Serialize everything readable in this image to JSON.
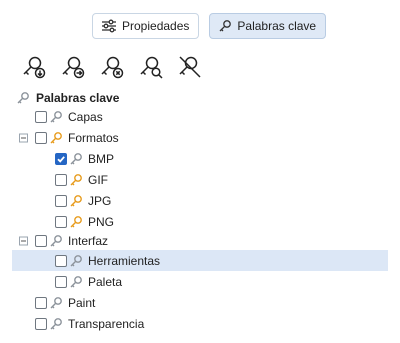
{
  "tabs": [
    {
      "label": "Propiedades",
      "icon": "sliders-icon",
      "active": false
    },
    {
      "label": "Palabras clave",
      "icon": "key-icon",
      "active": true
    }
  ],
  "toolbar": [
    "add-key-icon",
    "apply-key-icon",
    "remove-key-icon",
    "find-key-icon",
    "clear-keys-icon"
  ],
  "tree": {
    "root": "Palabras clave",
    "items": {
      "capas": "Capas",
      "formatos": "Formatos",
      "bmp": "BMP",
      "gif": "GIF",
      "jpg": "JPG",
      "png": "PNG",
      "interfaz": "Interfaz",
      "herramientas": "Herramientas",
      "paleta": "Paleta",
      "paint": "Paint",
      "transparencia": "Transparencia"
    }
  },
  "colors": {
    "key_gray": "#8c939b",
    "key_orange": "#e79b1c",
    "check_blue": "#2566c4",
    "selection": "#dce7f6"
  }
}
